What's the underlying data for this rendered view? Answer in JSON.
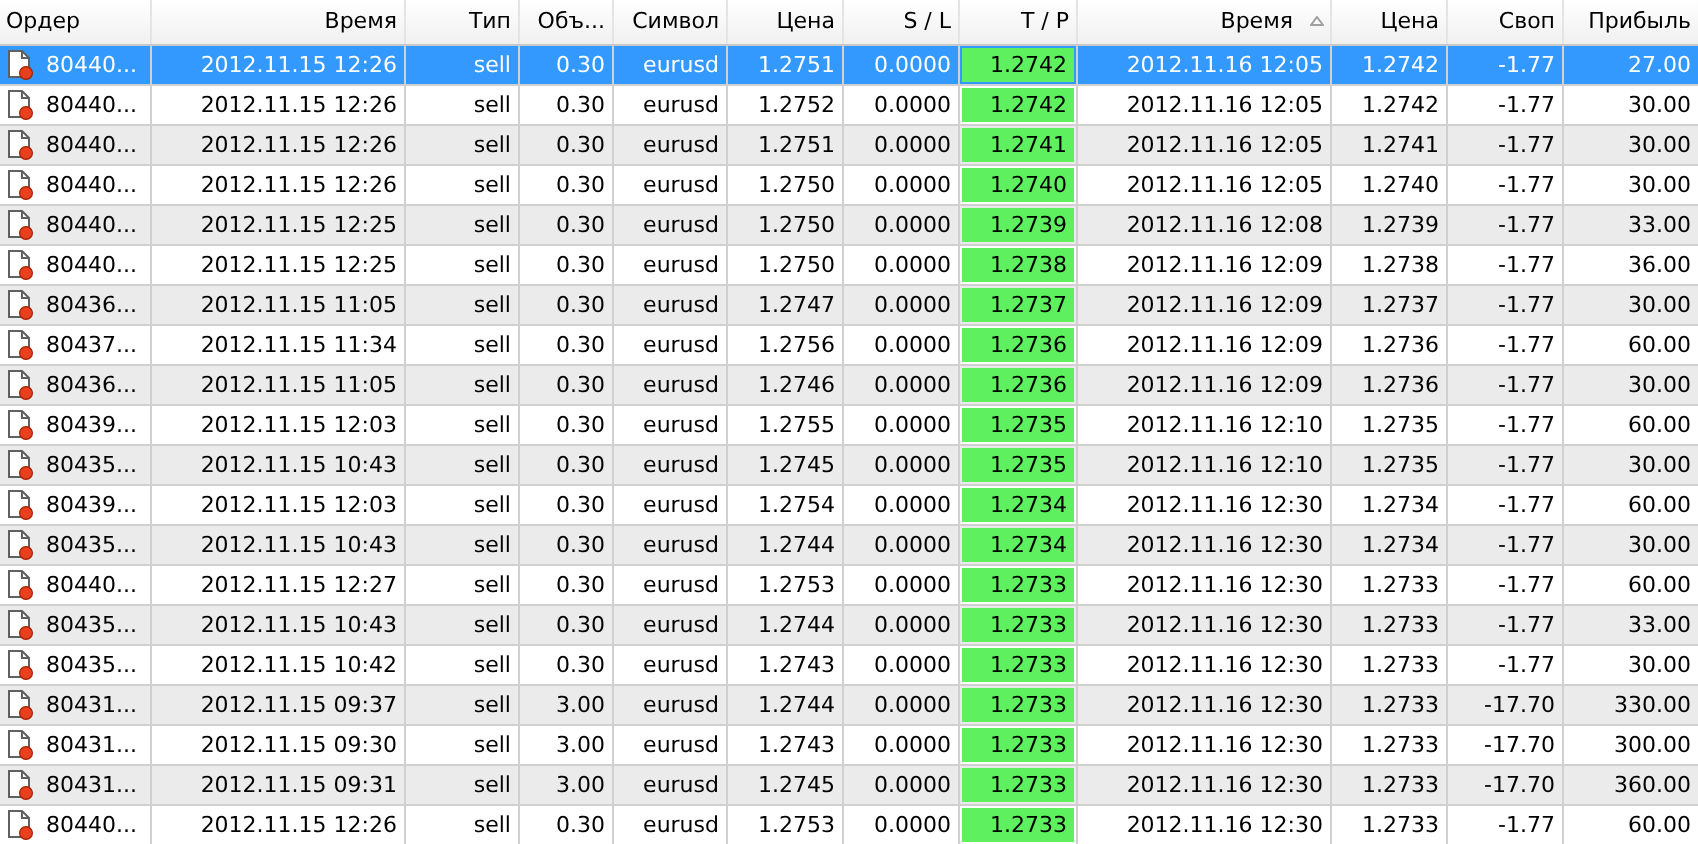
{
  "table": {
    "columns": [
      {
        "label": "Ордер",
        "sorted": false
      },
      {
        "label": "Время",
        "sorted": false
      },
      {
        "label": "Тип",
        "sorted": false
      },
      {
        "label": "Объ...",
        "sorted": false
      },
      {
        "label": "Символ",
        "sorted": false
      },
      {
        "label": "Цена",
        "sorted": false
      },
      {
        "label": "S / L",
        "sorted": false
      },
      {
        "label": "T / P",
        "sorted": false
      },
      {
        "label": "Время",
        "sorted": true
      },
      {
        "label": "Цена",
        "sorted": false
      },
      {
        "label": "Своп",
        "sorted": false
      },
      {
        "label": "Прибыль",
        "sorted": false
      }
    ],
    "rows": [
      {
        "selected": true,
        "cells": [
          "80440...",
          "2012.11.15 12:26",
          "sell",
          "0.30",
          "eurusd",
          "1.2751",
          "0.0000",
          "1.2742",
          "2012.11.16 12:05",
          "1.2742",
          "-1.77",
          "27.00"
        ]
      },
      {
        "selected": false,
        "cells": [
          "80440...",
          "2012.11.15 12:26",
          "sell",
          "0.30",
          "eurusd",
          "1.2752",
          "0.0000",
          "1.2742",
          "2012.11.16 12:05",
          "1.2742",
          "-1.77",
          "30.00"
        ]
      },
      {
        "selected": false,
        "cells": [
          "80440...",
          "2012.11.15 12:26",
          "sell",
          "0.30",
          "eurusd",
          "1.2751",
          "0.0000",
          "1.2741",
          "2012.11.16 12:05",
          "1.2741",
          "-1.77",
          "30.00"
        ]
      },
      {
        "selected": false,
        "cells": [
          "80440...",
          "2012.11.15 12:26",
          "sell",
          "0.30",
          "eurusd",
          "1.2750",
          "0.0000",
          "1.2740",
          "2012.11.16 12:05",
          "1.2740",
          "-1.77",
          "30.00"
        ]
      },
      {
        "selected": false,
        "cells": [
          "80440...",
          "2012.11.15 12:25",
          "sell",
          "0.30",
          "eurusd",
          "1.2750",
          "0.0000",
          "1.2739",
          "2012.11.16 12:08",
          "1.2739",
          "-1.77",
          "33.00"
        ]
      },
      {
        "selected": false,
        "cells": [
          "80440...",
          "2012.11.15 12:25",
          "sell",
          "0.30",
          "eurusd",
          "1.2750",
          "0.0000",
          "1.2738",
          "2012.11.16 12:09",
          "1.2738",
          "-1.77",
          "36.00"
        ]
      },
      {
        "selected": false,
        "cells": [
          "80436...",
          "2012.11.15 11:05",
          "sell",
          "0.30",
          "eurusd",
          "1.2747",
          "0.0000",
          "1.2737",
          "2012.11.16 12:09",
          "1.2737",
          "-1.77",
          "30.00"
        ]
      },
      {
        "selected": false,
        "cells": [
          "80437...",
          "2012.11.15 11:34",
          "sell",
          "0.30",
          "eurusd",
          "1.2756",
          "0.0000",
          "1.2736",
          "2012.11.16 12:09",
          "1.2736",
          "-1.77",
          "60.00"
        ]
      },
      {
        "selected": false,
        "cells": [
          "80436...",
          "2012.11.15 11:05",
          "sell",
          "0.30",
          "eurusd",
          "1.2746",
          "0.0000",
          "1.2736",
          "2012.11.16 12:09",
          "1.2736",
          "-1.77",
          "30.00"
        ]
      },
      {
        "selected": false,
        "cells": [
          "80439...",
          "2012.11.15 12:03",
          "sell",
          "0.30",
          "eurusd",
          "1.2755",
          "0.0000",
          "1.2735",
          "2012.11.16 12:10",
          "1.2735",
          "-1.77",
          "60.00"
        ]
      },
      {
        "selected": false,
        "cells": [
          "80435...",
          "2012.11.15 10:43",
          "sell",
          "0.30",
          "eurusd",
          "1.2745",
          "0.0000",
          "1.2735",
          "2012.11.16 12:10",
          "1.2735",
          "-1.77",
          "30.00"
        ]
      },
      {
        "selected": false,
        "cells": [
          "80439...",
          "2012.11.15 12:03",
          "sell",
          "0.30",
          "eurusd",
          "1.2754",
          "0.0000",
          "1.2734",
          "2012.11.16 12:30",
          "1.2734",
          "-1.77",
          "60.00"
        ]
      },
      {
        "selected": false,
        "cells": [
          "80435...",
          "2012.11.15 10:43",
          "sell",
          "0.30",
          "eurusd",
          "1.2744",
          "0.0000",
          "1.2734",
          "2012.11.16 12:30",
          "1.2734",
          "-1.77",
          "30.00"
        ]
      },
      {
        "selected": false,
        "cells": [
          "80440...",
          "2012.11.15 12:27",
          "sell",
          "0.30",
          "eurusd",
          "1.2753",
          "0.0000",
          "1.2733",
          "2012.11.16 12:30",
          "1.2733",
          "-1.77",
          "60.00"
        ]
      },
      {
        "selected": false,
        "cells": [
          "80435...",
          "2012.11.15 10:43",
          "sell",
          "0.30",
          "eurusd",
          "1.2744",
          "0.0000",
          "1.2733",
          "2012.11.16 12:30",
          "1.2733",
          "-1.77",
          "33.00"
        ]
      },
      {
        "selected": false,
        "cells": [
          "80435...",
          "2012.11.15 10:42",
          "sell",
          "0.30",
          "eurusd",
          "1.2743",
          "0.0000",
          "1.2733",
          "2012.11.16 12:30",
          "1.2733",
          "-1.77",
          "30.00"
        ]
      },
      {
        "selected": false,
        "cells": [
          "80431...",
          "2012.11.15 09:37",
          "sell",
          "3.00",
          "eurusd",
          "1.2744",
          "0.0000",
          "1.2733",
          "2012.11.16 12:30",
          "1.2733",
          "-17.70",
          "330.00"
        ]
      },
      {
        "selected": false,
        "cells": [
          "80431...",
          "2012.11.15 09:30",
          "sell",
          "3.00",
          "eurusd",
          "1.2743",
          "0.0000",
          "1.2733",
          "2012.11.16 12:30",
          "1.2733",
          "-17.70",
          "300.00"
        ]
      },
      {
        "selected": false,
        "cells": [
          "80431...",
          "2012.11.15 09:31",
          "sell",
          "3.00",
          "eurusd",
          "1.2745",
          "0.0000",
          "1.2733",
          "2012.11.16 12:30",
          "1.2733",
          "-17.70",
          "360.00"
        ]
      },
      {
        "selected": false,
        "cells": [
          "80440...",
          "2012.11.15 12:26",
          "sell",
          "0.30",
          "eurusd",
          "1.2753",
          "0.0000",
          "1.2733",
          "2012.11.16 12:30",
          "1.2733",
          "-1.77",
          "60.00"
        ]
      }
    ]
  }
}
